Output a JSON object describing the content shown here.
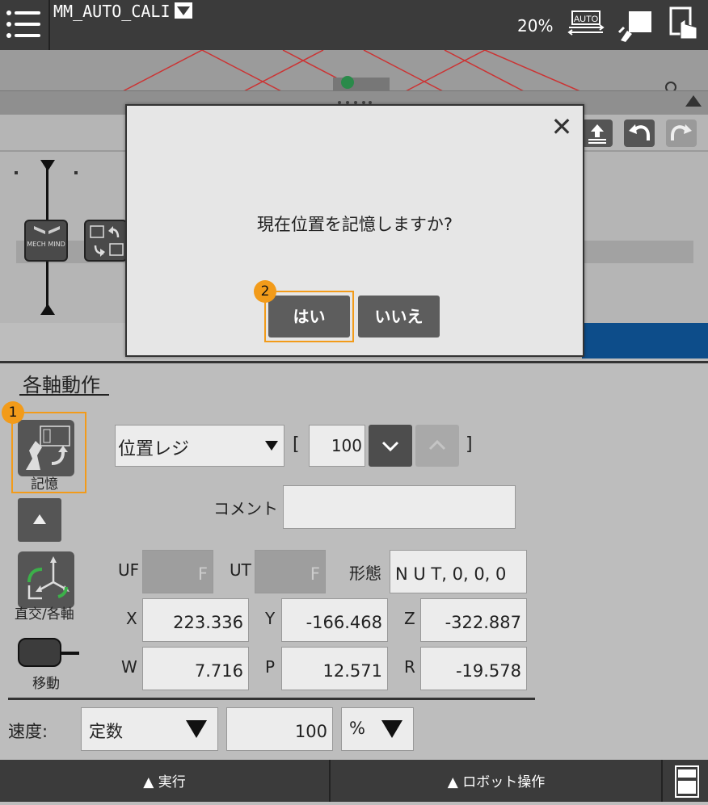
{
  "header": {
    "program_name": "MM_AUTO_CALI",
    "override": "20%",
    "auto_label": "AUTO"
  },
  "colors": {
    "topbar": "#3b3b3b",
    "highlight": "#f29b1a",
    "button": "#555555",
    "accent_blue": "#0d4d8a"
  },
  "timeline": {
    "node_text": "MECH MIND"
  },
  "dialog": {
    "message": "現在位置を記憶しますか?",
    "yes_label": "はい",
    "no_label": "いいえ",
    "close_glyph": "✕",
    "step_badge": "2"
  },
  "jog": {
    "title": "各軸動作",
    "record_label": "記憶",
    "record_badge": "1",
    "coord_label": "直交/各軸",
    "move_label": "移動",
    "register_type": "位置レジ",
    "register_bracket_open": "[",
    "register_number": "100",
    "register_bracket_close": "]",
    "comment_label": "コメント",
    "comment_value": "",
    "uf_label": "UF",
    "uf_value": "F",
    "ut_label": "UT",
    "ut_value": "F",
    "config_label": "形態",
    "config_value": "N U T, 0, 0, 0",
    "x_label": "X",
    "x_value": "223.336",
    "y_label": "Y",
    "y_value": "-166.468",
    "z_label": "Z",
    "z_value": "-322.887",
    "w_label": "W",
    "w_value": "7.716",
    "p_label": "P",
    "p_value": "12.571",
    "r_label": "R",
    "r_value": "-19.578",
    "speed_label": "速度:",
    "speed_mode": "定数",
    "speed_value": "100",
    "speed_unit": "%"
  },
  "footer": {
    "exec_label": "▲ 実行",
    "robot_label": "▲ ロボット操作"
  }
}
